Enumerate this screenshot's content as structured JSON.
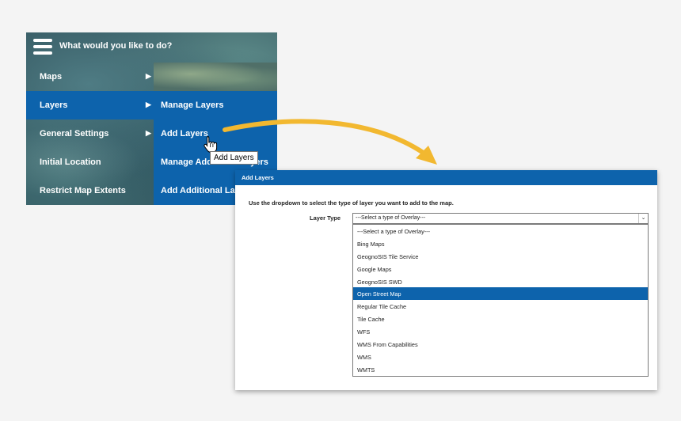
{
  "menu": {
    "title": "What would you like to do?",
    "items": [
      {
        "label": "Maps"
      },
      {
        "label": "Layers"
      },
      {
        "label": "General Settings"
      },
      {
        "label": "Initial Location"
      },
      {
        "label": "Restrict Map Extents"
      }
    ],
    "submenu": [
      {
        "label": "Manage Layers"
      },
      {
        "label": "Add Layers"
      },
      {
        "label": "Manage Additional Layers"
      },
      {
        "label": "Add Additional Layers"
      }
    ]
  },
  "tooltip": "Add Layers",
  "dialog": {
    "title": "Add Layers",
    "instruction": "Use the dropdown to select the type of layer you want to add to the map.",
    "layer_type_label": "Layer Type",
    "select_value": "---Select a type of Overlay---",
    "selected_option": "Open Street Map",
    "options": [
      "---Select a type of Overlay---",
      "Bing Maps",
      "GeognoSIS Tile Service",
      "Google Maps",
      "GeognoSIS SWD",
      "Open Street Map",
      "Regular Tile Cache",
      "Tile Cache",
      "WFS",
      "WMS From Capabilities",
      "WMS",
      "WMTS"
    ]
  },
  "colors": {
    "accent": "#0d63ac",
    "arrow": "#f2b830"
  },
  "icons": {
    "menu": "hamburger-icon",
    "cursor": "hand-pointer-icon",
    "chevron": "chevron-down-icon"
  }
}
